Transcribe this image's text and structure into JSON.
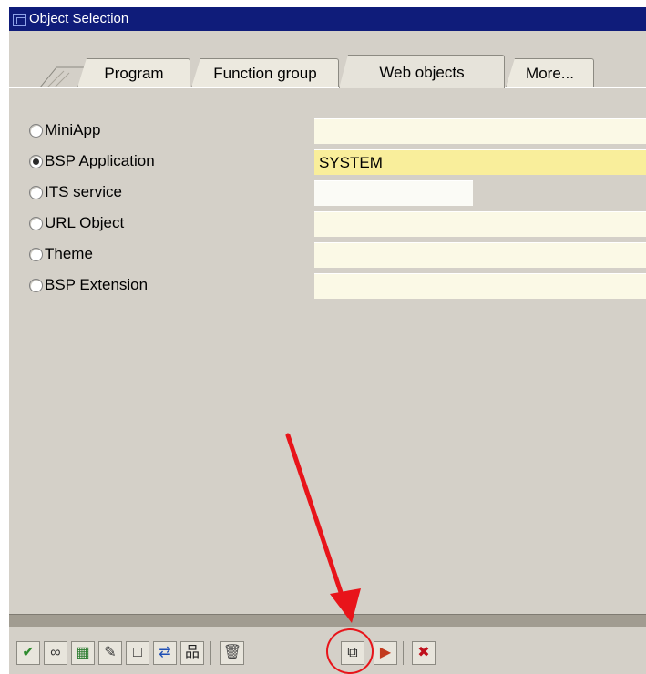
{
  "window": {
    "title": "Object Selection"
  },
  "tabs": [
    {
      "label": "Program"
    },
    {
      "label": "Function group"
    },
    {
      "label": "Web objects"
    },
    {
      "label": "More..."
    }
  ],
  "options": [
    {
      "label": "MiniApp",
      "selected": false,
      "value": ""
    },
    {
      "label": "BSP Application",
      "selected": true,
      "value": "SYSTEM"
    },
    {
      "label": "ITS service",
      "selected": false,
      "value": ""
    },
    {
      "label": "URL Object",
      "selected": false,
      "value": ""
    },
    {
      "label": "Theme",
      "selected": false,
      "value": ""
    },
    {
      "label": "BSP Extension",
      "selected": false,
      "value": ""
    }
  ],
  "toolbar": {
    "buttons": [
      {
        "name": "execute-check-icon",
        "glyph": "✔",
        "color": "#2e8b2e"
      },
      {
        "name": "display-glasses-icon",
        "glyph": "∞",
        "color": "#333333"
      },
      {
        "name": "change-icon",
        "glyph": "▦",
        "color": "#2e7d32"
      },
      {
        "name": "edit-pencil-icon",
        "glyph": "✎",
        "color": "#333333"
      },
      {
        "name": "create-new-icon",
        "glyph": "□",
        "color": "#222222"
      },
      {
        "name": "where-used-icon",
        "glyph": "⇄",
        "color": "#1f4fb5"
      },
      {
        "name": "hierarchy-icon",
        "glyph": "品",
        "color": "#222222"
      },
      {
        "name": "delete-trash-icon",
        "glyph": "🗑",
        "color": "#444444"
      },
      {
        "name": "copy-icon",
        "glyph": "⧉",
        "color": "#222222"
      },
      {
        "name": "rename-icon",
        "glyph": "▶",
        "color": "#c23b1e"
      },
      {
        "name": "cancel-icon",
        "glyph": "✖",
        "color": "#c0101c"
      }
    ]
  },
  "annotation": {
    "color": "#e8141a"
  }
}
